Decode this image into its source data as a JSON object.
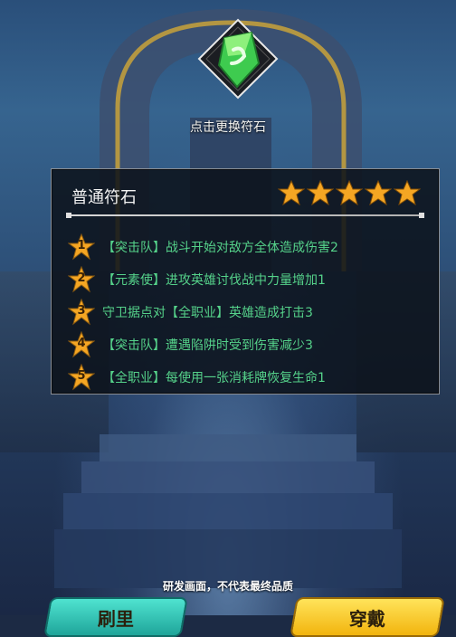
{
  "gem": {
    "hint": "点击更换符石",
    "icon": "green-rune-gem-icon"
  },
  "panel": {
    "title": "普通符石",
    "star_count": 5,
    "effects": [
      {
        "num": "1",
        "text": "【突击队】战斗开始对敌方全体造成伤害2"
      },
      {
        "num": "2",
        "text": "【元素使】进攻英雄讨伐战中力量增加1"
      },
      {
        "num": "3",
        "text": "守卫据点对【全职业】英雄造成打击3"
      },
      {
        "num": "4",
        "text": "【突击队】遭遇陷阱时受到伤害减少3"
      },
      {
        "num": "5",
        "text": "【全职业】每使用一张消耗牌恢复生命1"
      }
    ]
  },
  "footer": {
    "note": "研发画面，不代表最终品质"
  },
  "buttons": {
    "left_label": "刷里",
    "right_label": "穿戴"
  },
  "colors": {
    "effect_text": "#55d28a",
    "star": "#f5a623",
    "panel_bg": "#0c121a"
  }
}
